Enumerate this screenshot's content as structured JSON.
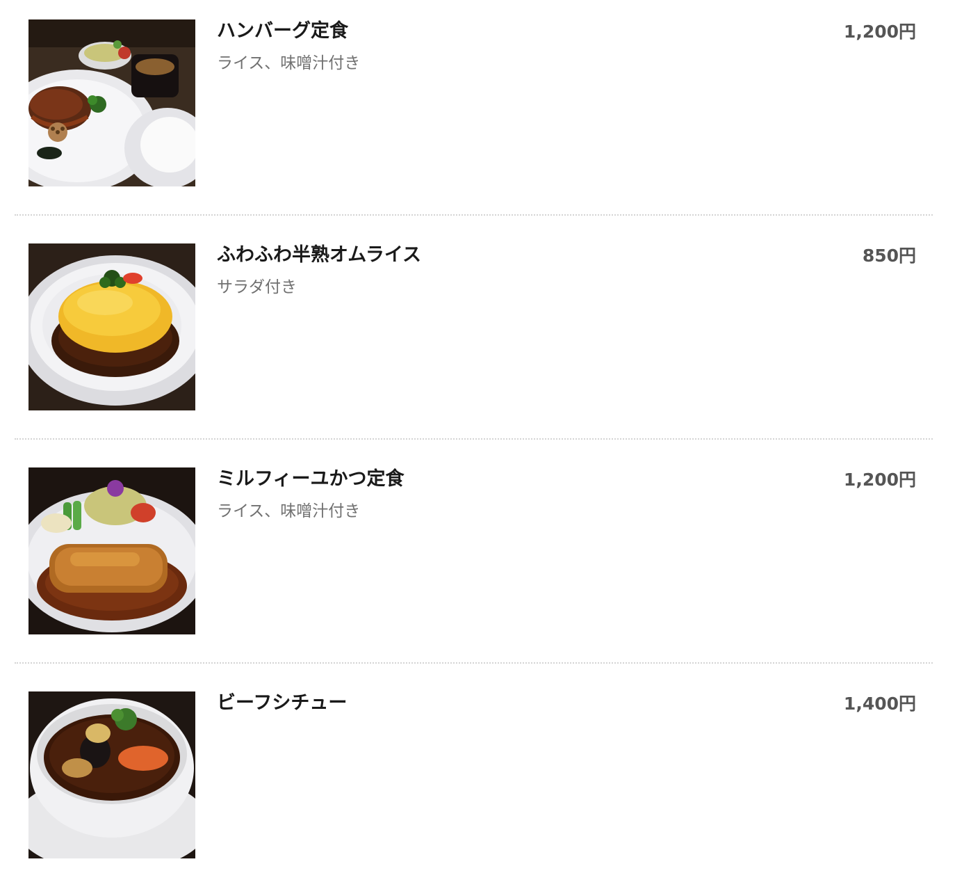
{
  "menu": {
    "items": [
      {
        "name": "ハンバーグ定食",
        "description": "ライス、味噌汁付き",
        "price": "1,200円",
        "photo_icon": "hamburg-steak-set-photo"
      },
      {
        "name": "ふわふわ半熟オムライス",
        "description": "サラダ付き",
        "price": "850円",
        "photo_icon": "omurice-photo"
      },
      {
        "name": "ミルフィーユかつ定食",
        "description": "ライス、味噌汁付き",
        "price": "1,200円",
        "photo_icon": "mille-feuille-katsu-set-photo"
      },
      {
        "name": "ビーフシチュー",
        "description": "",
        "price": "1,400円",
        "photo_icon": "beef-stew-photo"
      }
    ]
  }
}
